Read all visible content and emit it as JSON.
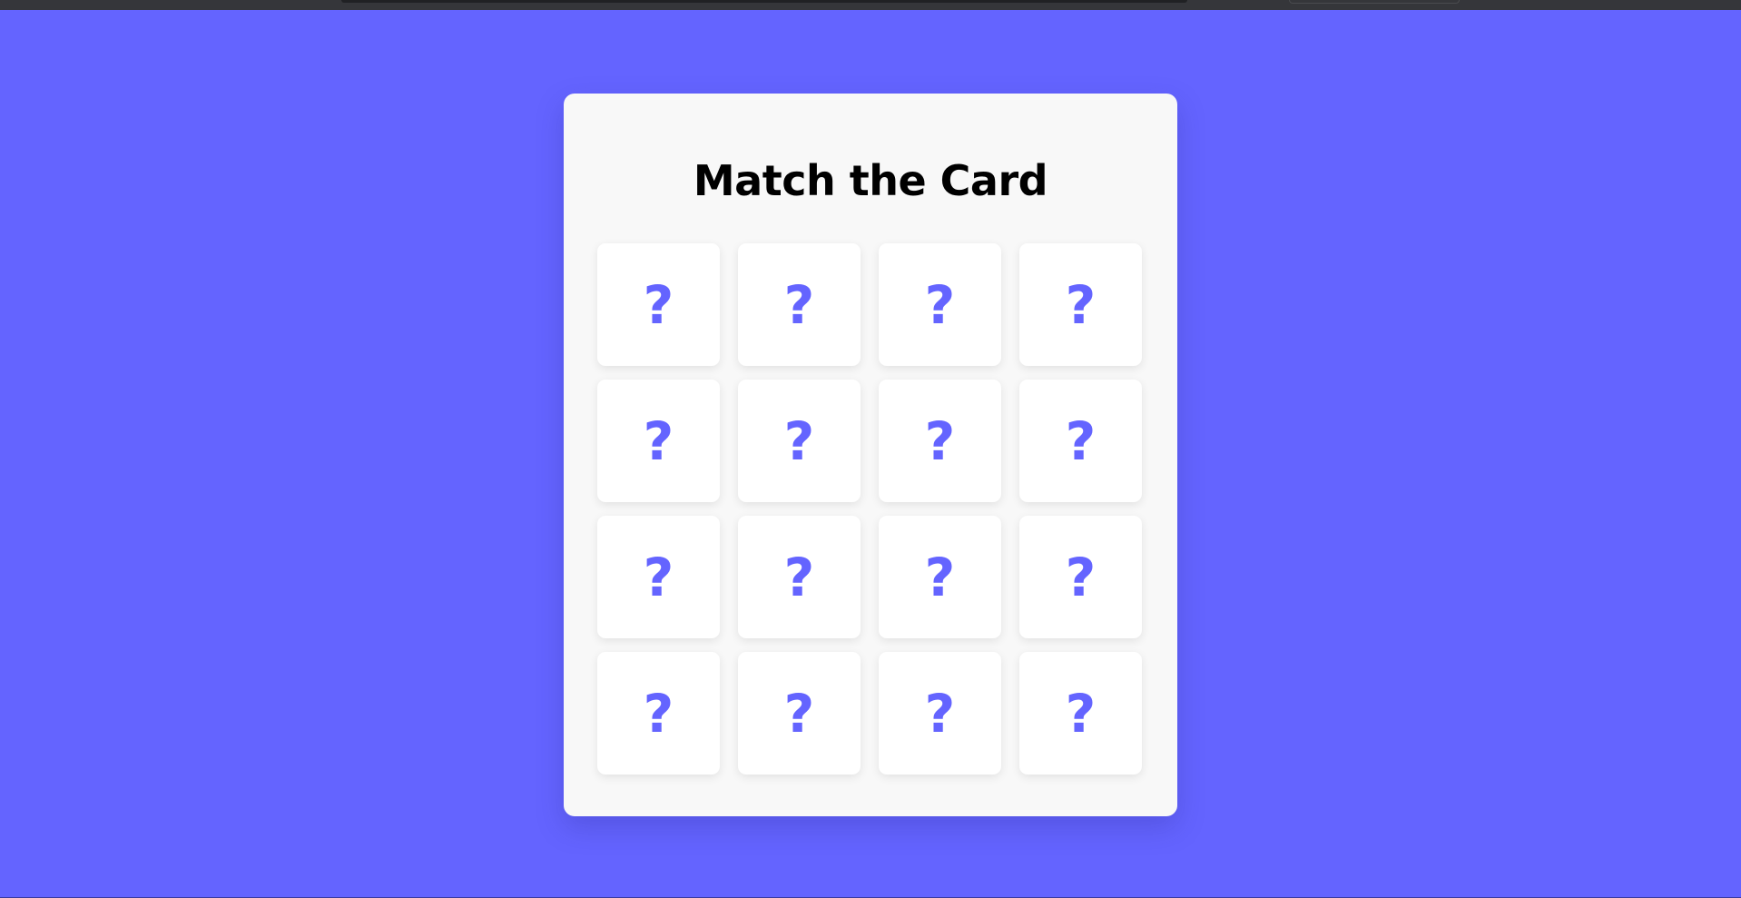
{
  "game": {
    "title": "Match the Card",
    "hidden_symbol": "?",
    "accent_color": "#6464ff",
    "background_color": "#6464ff",
    "panel_color": "#f8f8f8",
    "card_color": "#ffffff",
    "cards": [
      {
        "face": "?"
      },
      {
        "face": "?"
      },
      {
        "face": "?"
      },
      {
        "face": "?"
      },
      {
        "face": "?"
      },
      {
        "face": "?"
      },
      {
        "face": "?"
      },
      {
        "face": "?"
      },
      {
        "face": "?"
      },
      {
        "face": "?"
      },
      {
        "face": "?"
      },
      {
        "face": "?"
      },
      {
        "face": "?"
      },
      {
        "face": "?"
      },
      {
        "face": "?"
      },
      {
        "face": "?"
      }
    ]
  }
}
